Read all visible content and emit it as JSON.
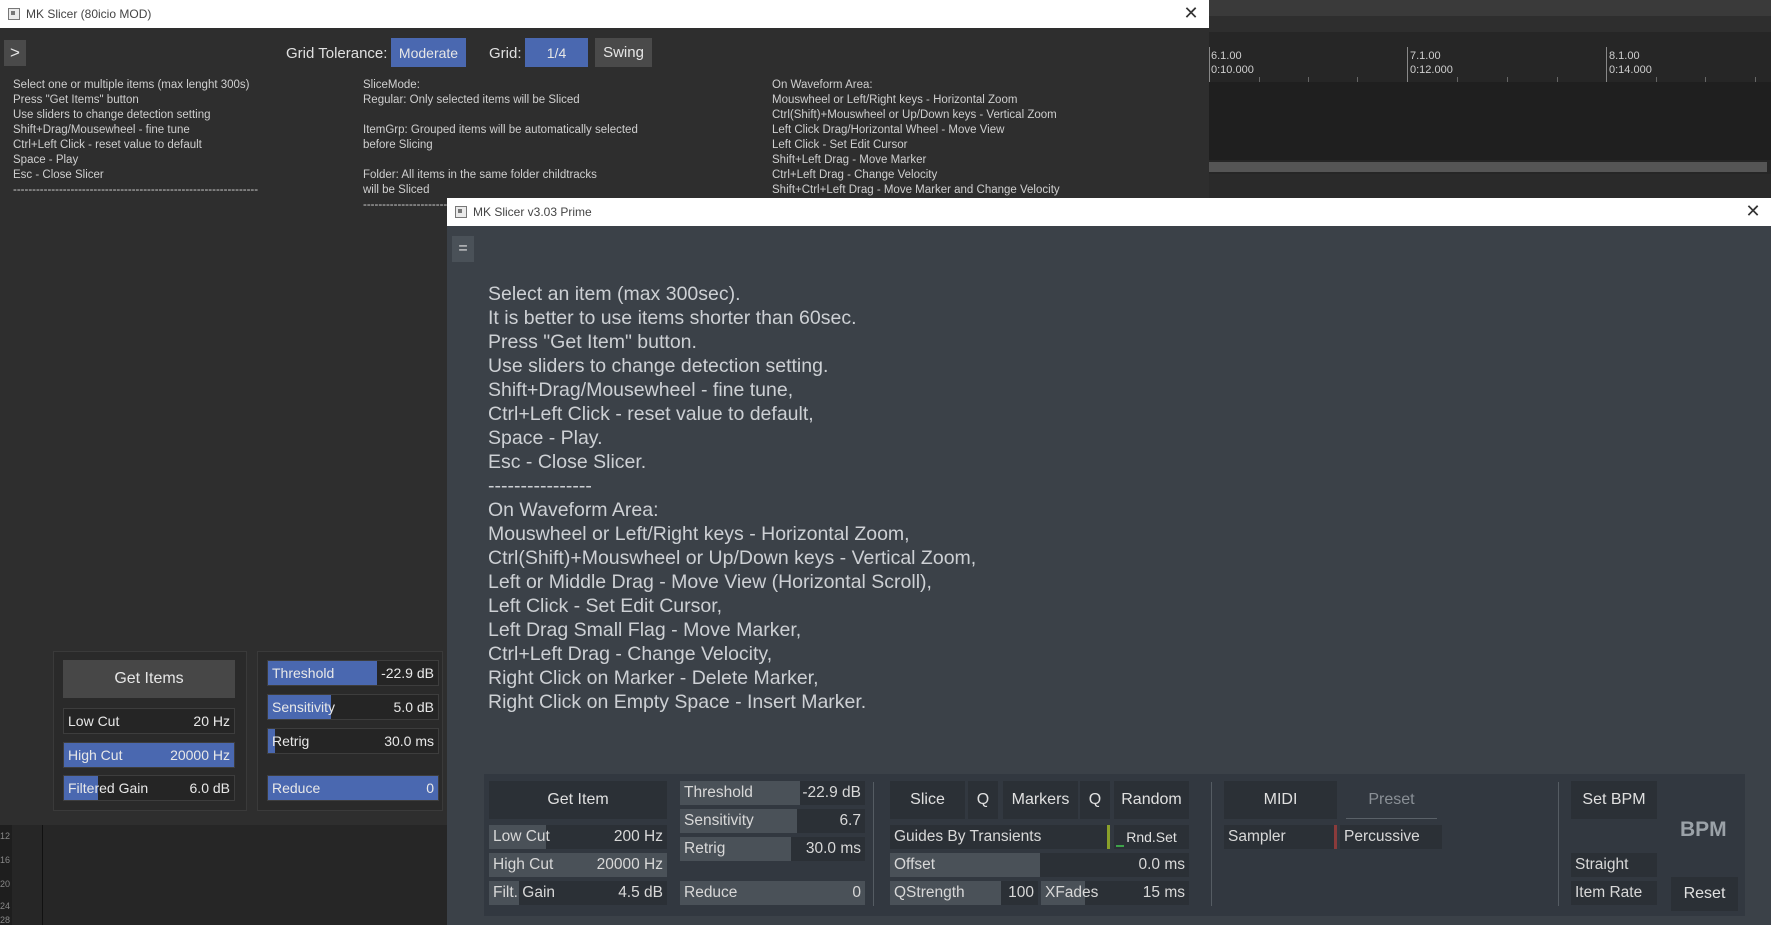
{
  "back_window": {
    "title": "MK Slicer (80icio MOD)",
    "toggle_label": ">",
    "grid_tolerance_label": "Grid Tolerance:",
    "grid_tolerance_value": "Moderate",
    "grid_label": "Grid:",
    "grid_value": "1/4",
    "swing_label": "Swing",
    "help_col1": "Select one or multiple items (max lenght 300s)\nPress \"Get Items\" button\nUse sliders to change detection setting\nShift+Drag/Mousewheel - fine tune\nCtrl+Left Click - reset value to default\nSpace - Play\nEsc - Close Slicer\n----------------------------------------------------------------",
    "help_col2": "SliceMode:\nRegular: Only selected items will be Sliced\n\nItemGrp: Grouped items will be automatically selected\nbefore Slicing\n\nFolder: All items in the same folder childtracks\nwill be Sliced\n----------------------------------",
    "help_col3": "On Waveform Area:\nMouswheel or Left/Right keys - Horizontal Zoom\nCtrl(Shift)+Mouswheel or Up/Down keys - Vertical Zoom\nLeft Click Drag/Horizontal Wheel - Move View\nLeft Click - Set Edit Cursor\nShift+Left Drag - Move Marker\nCtrl+Left Drag - Change Velocity\nShift+Ctrl+Left Drag - Move Marker and Change Velocity",
    "get_items": "Get Items",
    "low_cut": {
      "label": "Low Cut",
      "value": "20 Hz",
      "fill": 0.0
    },
    "high_cut": {
      "label": "High Cut",
      "value": "20000 Hz",
      "fill": 1.0
    },
    "filtered_gain": {
      "label": "Filtered Gain",
      "value": "6.0 dB",
      "fill": 0.2
    },
    "threshold": {
      "label": "Threshold",
      "value": "-22.9 dB",
      "fill": 0.64
    },
    "sensitivity": {
      "label": "Sensitivity",
      "value": "5.0 dB",
      "fill": 0.37
    },
    "retrig": {
      "label": "Retrig",
      "value": "30.0 ms",
      "fill": 0.04
    },
    "reduce": {
      "label": "Reduce",
      "value": "0",
      "fill": 1.0
    },
    "ruler_numbers": [
      "12",
      "16",
      "20",
      "24",
      "28"
    ]
  },
  "arrange": {
    "markers": [
      {
        "bar": "6.1.00",
        "time": "0:10.000"
      },
      {
        "bar": "7.1.00",
        "time": "0:12.000"
      },
      {
        "bar": "8.1.00",
        "time": "0:14.000"
      }
    ]
  },
  "front_window": {
    "title": "MK Slicer v3.03 Prime",
    "menu_label": "=",
    "help_text": "Select an item (max 300sec).\nIt is better to use items shorter than 60sec.\nPress \"Get Item\" button.\nUse sliders to change detection setting.\nShift+Drag/Mousewheel - fine tune,\nCtrl+Left Click - reset value to default,\nSpace - Play.\nEsc - Close Slicer.\n----------------\nOn Waveform Area:\nMouswheel or Left/Right keys - Horizontal Zoom,\nCtrl(Shift)+Mouswheel or Up/Down keys - Vertical Zoom,\nLeft or Middle Drag - Move View (Horizontal Scroll),\nLeft Click - Set Edit Cursor,\nLeft Drag Small Flag - Move Marker,\nCtrl+Left Drag - Change Velocity,\nRight Click on Marker - Delete Marker,\nRight Click on Empty Space - Insert Marker.",
    "get_item": "Get Item",
    "low_cut": {
      "label": "Low Cut",
      "value": "200 Hz",
      "fill": 0.32
    },
    "high_cut": {
      "label": "High Cut",
      "value": "20000 Hz",
      "fill": 1.0
    },
    "filt_gain": {
      "label": "Filt. Gain",
      "value": "4.5 dB",
      "fill": 0.17
    },
    "threshold": {
      "label": "Threshold",
      "value": "-22.9 dB",
      "fill": 0.65
    },
    "sensitivity": {
      "label": "Sensitivity",
      "value": "6.7",
      "fill": 0.63
    },
    "retrig": {
      "label": "Retrig",
      "value": "30.0 ms",
      "fill": 0.6
    },
    "reduce": {
      "label": "Reduce",
      "value": "0",
      "fill": 1.0
    },
    "slice": "Slice",
    "q1": "Q",
    "markers": "Markers",
    "q2": "Q",
    "random": "Random",
    "guides": "Guides By Transients",
    "rnd_set": "Rnd.Set",
    "offset": {
      "label": "Offset",
      "value": "0.0 ms",
      "fill": 0.5
    },
    "qstrength": {
      "label": "QStrength",
      "value": "100",
      "fill": 0.75
    },
    "xfades": {
      "label": "XFades",
      "value": "15 ms",
      "fill": 0.3
    },
    "midi": "MIDI",
    "preset": "Preset",
    "sampler": "Sampler",
    "percussive": "Percussive",
    "set_bpm": "Set BPM",
    "bpm": "BPM",
    "straight": "Straight",
    "item_rate": "Item Rate",
    "reset": "Reset",
    "colors": {
      "accent": "#4a68b0",
      "window_bg": "#3b4148",
      "panel_bg": "#323840"
    }
  }
}
